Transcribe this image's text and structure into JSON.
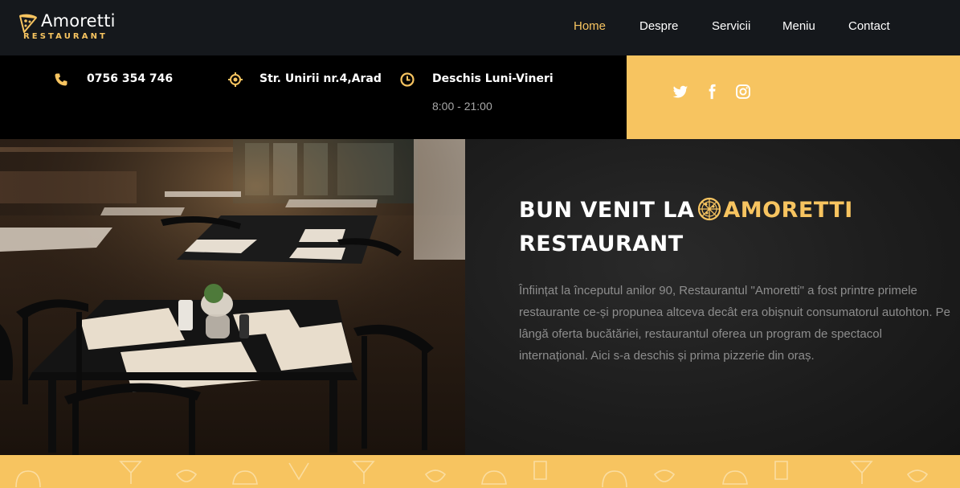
{
  "brand": {
    "name": "Amoretti",
    "subtitle": "RESTAURANT",
    "accent_color": "#f7c460"
  },
  "nav": {
    "items": [
      {
        "label": "Home",
        "active": true
      },
      {
        "label": "Despre",
        "active": false
      },
      {
        "label": "Servicii",
        "active": false
      },
      {
        "label": "Meniu",
        "active": false
      },
      {
        "label": "Contact",
        "active": false
      }
    ]
  },
  "info": {
    "phone": {
      "icon": "phone-icon",
      "text": "0756 354 746"
    },
    "address": {
      "icon": "location-icon",
      "text": "Str. Unirii nr.4,Arad"
    },
    "hours": {
      "icon": "clock-icon",
      "text": "Deschis Luni-Vineri",
      "sub": "8:00 - 21:00"
    }
  },
  "social": {
    "icons": [
      "twitter-icon",
      "facebook-icon",
      "instagram-icon"
    ]
  },
  "hero": {
    "title_prefix": "BUN VENIT LA",
    "title_accent": "AMORETTI",
    "title_suffix": "RESTAURANT",
    "description": "Înființat la începutul anilor 90, Restaurantul \"Amoretti\" a fost printre primele restaurante ce-și propunea altceva decât era obișnuit consumatorul autohton. Pe lângă oferta bucătăriei, restaurantul oferea un program de spectacol internațional. Aici s-a deschis și prima pizzerie din oraș."
  }
}
